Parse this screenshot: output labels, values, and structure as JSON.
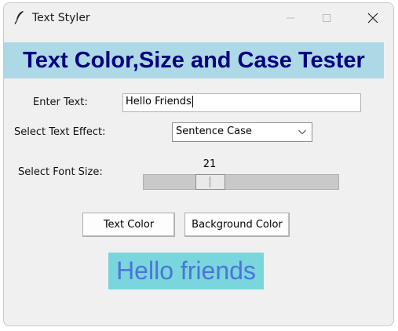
{
  "window": {
    "title": "Text Styler",
    "icon": "feather-icon"
  },
  "heading": {
    "text": "Text Color,Size and Case Tester",
    "bg_color": "#add8e6",
    "fg_color": "#000080"
  },
  "text_entry": {
    "label": "Enter Text:",
    "value": "Hello Friends"
  },
  "effect": {
    "label": "Select Text Effect:",
    "selected": "Sentence Case"
  },
  "font_size": {
    "label": "Select Font Size:",
    "value": "21"
  },
  "buttons": {
    "text_color": "Text Color",
    "background_color": "Background Color"
  },
  "preview": {
    "text": "Hello friends",
    "bg_color": "#78d6dc",
    "fg_color": "#4e73d8"
  }
}
